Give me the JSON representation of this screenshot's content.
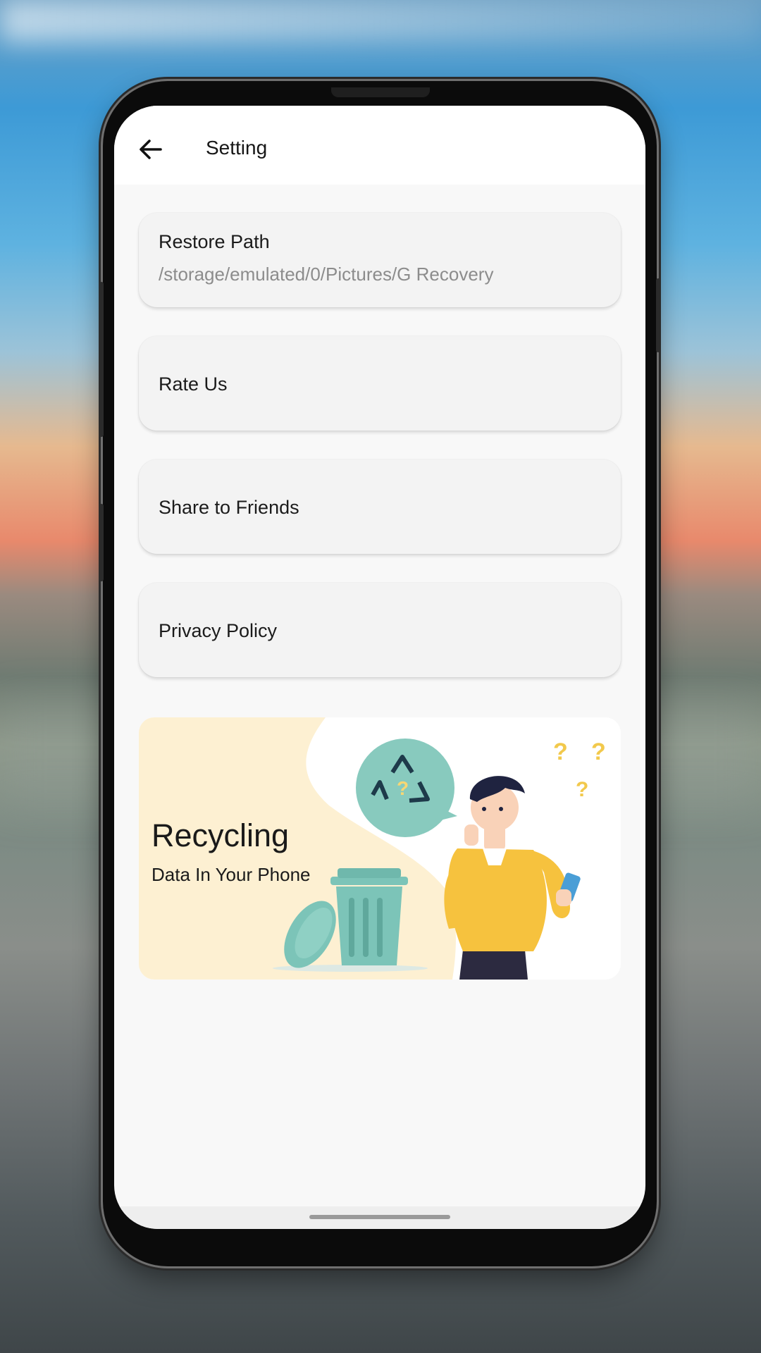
{
  "app_bar": {
    "title": "Setting",
    "back_icon": "arrow-left-icon"
  },
  "settings": {
    "restore_path": {
      "title": "Restore Path",
      "value": "/storage/emulated/0/Pictures/G Recovery"
    },
    "rate_us": {
      "title": "Rate Us"
    },
    "share": {
      "title": "Share to Friends"
    },
    "privacy": {
      "title": "Privacy Policy"
    }
  },
  "banner": {
    "heading": "Recycling",
    "subheading": "Data In Your Phone",
    "colors": {
      "background": "#fdf0d2",
      "trash": "#7cc4b8",
      "shirt": "#f6c23e",
      "question": "#f2c94c"
    }
  }
}
